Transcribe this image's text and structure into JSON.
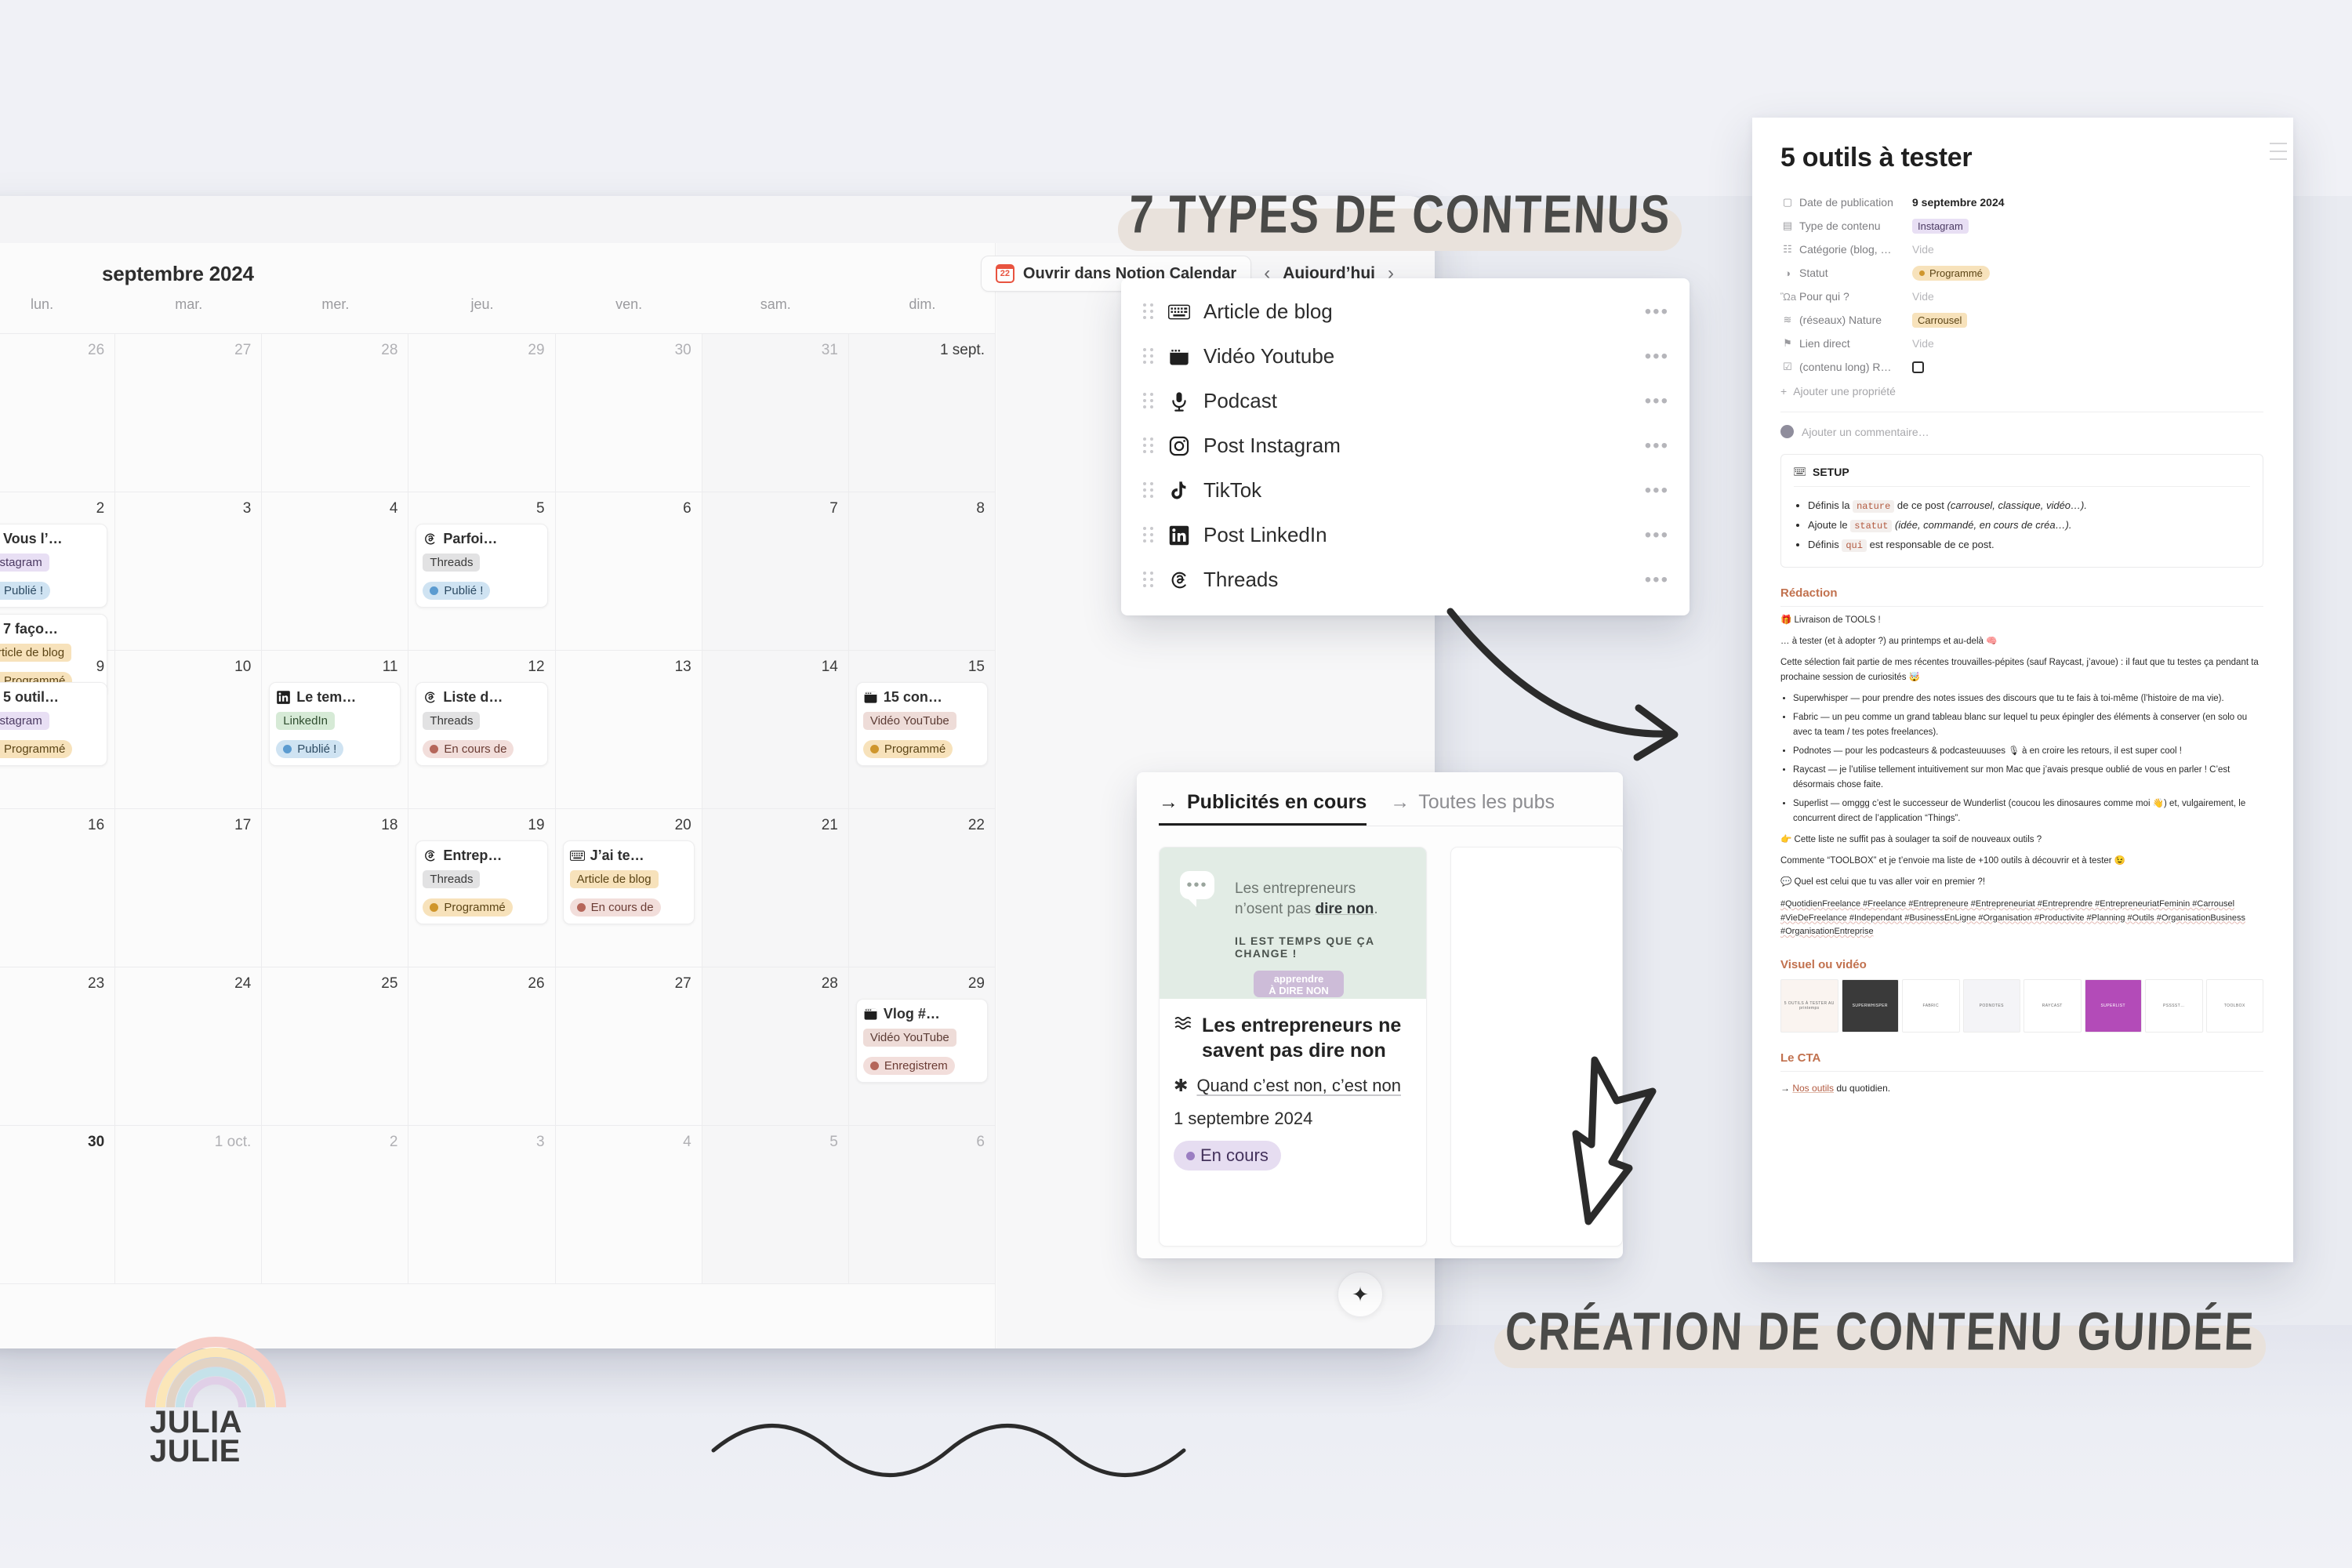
{
  "calendar": {
    "month_label": "septembre 2024",
    "open_button": "Ouvrir dans Notion Calendar",
    "today_button": "Aujourd’hui",
    "prev_icon": "‹",
    "next_icon": "›",
    "fab_icon": "✦",
    "weekdays": [
      "lun.",
      "mar.",
      "mer.",
      "jeu.",
      "ven.",
      "sam.",
      "dim."
    ],
    "weeks": [
      [
        {
          "num": "26",
          "muted": true,
          "events": []
        },
        {
          "num": "27",
          "muted": true,
          "events": []
        },
        {
          "num": "28",
          "muted": true,
          "events": []
        },
        {
          "num": "29",
          "muted": true,
          "events": []
        },
        {
          "num": "30",
          "muted": true,
          "events": []
        },
        {
          "num": "31",
          "muted": true,
          "weekend": true,
          "events": []
        },
        {
          "num": "1 sept.",
          "muted": false,
          "weekend": true,
          "events": []
        }
      ],
      [
        {
          "num": "2",
          "muted": false,
          "events": [
            {
              "icon": "instagram-icon",
              "title": "Vous l’…",
              "type": "Instagram",
              "type_bg": "#e8dff4",
              "type_fg": "#4b3a62",
              "status": "Publié !",
              "status_bg": "#cfe3f2",
              "status_fg": "#2d4b63",
              "status_dot": "#5b9bd0"
            },
            {
              "icon": "keyboard-icon",
              "title": "7 faço…",
              "type": "Article de blog",
              "type_bg": "#f7e2bb",
              "type_fg": "#5c4516",
              "status": "Programmé",
              "status_bg": "#f7e2bb",
              "status_fg": "#5c4516",
              "status_dot": "#cf962c"
            }
          ]
        },
        {
          "num": "3",
          "muted": false,
          "events": []
        },
        {
          "num": "4",
          "muted": false,
          "events": []
        },
        {
          "num": "5",
          "muted": false,
          "events": [
            {
              "icon": "threads-icon",
              "title": "Parfoi…",
              "type": "Threads",
              "type_bg": "#e2e2e3",
              "type_fg": "#3a3a3a",
              "status": "Publié !",
              "status_bg": "#cfe3f2",
              "status_fg": "#2d4b63",
              "status_dot": "#5b9bd0"
            }
          ]
        },
        {
          "num": "6",
          "muted": false,
          "events": []
        },
        {
          "num": "7",
          "muted": false,
          "weekend": true,
          "events": []
        },
        {
          "num": "8",
          "muted": false,
          "weekend": true,
          "events": []
        }
      ],
      [
        {
          "num": "9",
          "muted": false,
          "events": [
            {
              "icon": "instagram-icon",
              "title": "5 outil…",
              "type": "Instagram",
              "type_bg": "#e8dff4",
              "type_fg": "#4b3a62",
              "status": "Programmé",
              "status_bg": "#f7e2bb",
              "status_fg": "#5c4516",
              "status_dot": "#cf962c"
            }
          ]
        },
        {
          "num": "10",
          "muted": false,
          "events": []
        },
        {
          "num": "11",
          "muted": false,
          "events": [
            {
              "icon": "linkedin-icon",
              "title": "Le tem…",
              "type": "LinkedIn",
              "type_bg": "#d6ead6",
              "type_fg": "#2f4d2f",
              "status": "Publié !",
              "status_bg": "#cfe3f2",
              "status_fg": "#2d4b63",
              "status_dot": "#5b9bd0"
            }
          ]
        },
        {
          "num": "12",
          "muted": false,
          "events": [
            {
              "icon": "threads-icon",
              "title": "Liste d…",
              "type": "Threads",
              "type_bg": "#e2e2e3",
              "type_fg": "#3a3a3a",
              "status": "En cours de",
              "status_bg": "#f2dedb",
              "status_fg": "#6b3c34",
              "status_dot": "#b5665a"
            }
          ]
        },
        {
          "num": "13",
          "muted": false,
          "events": []
        },
        {
          "num": "14",
          "muted": false,
          "weekend": true,
          "events": []
        },
        {
          "num": "15",
          "muted": false,
          "weekend": true,
          "events": [
            {
              "icon": "youtube-icon",
              "title": "15 con…",
              "type": "Vidéo YouTube",
              "type_bg": "#eedcd8",
              "type_fg": "#5c3c35",
              "status": "Programmé",
              "status_bg": "#f7e2bb",
              "status_fg": "#5c4516",
              "status_dot": "#cf962c"
            }
          ]
        }
      ],
      [
        {
          "num": "16",
          "muted": false,
          "events": []
        },
        {
          "num": "17",
          "muted": false,
          "events": []
        },
        {
          "num": "18",
          "muted": false,
          "events": []
        },
        {
          "num": "19",
          "muted": false,
          "events": [
            {
              "icon": "threads-icon",
              "title": "Entrep…",
              "type": "Threads",
              "type_bg": "#e2e2e3",
              "type_fg": "#3a3a3a",
              "status": "Programmé",
              "status_bg": "#f7e2bb",
              "status_fg": "#5c4516",
              "status_dot": "#cf962c"
            }
          ]
        },
        {
          "num": "20",
          "muted": false,
          "events": [
            {
              "icon": "keyboard-icon",
              "title": "J’ai te…",
              "type": "Article de blog",
              "type_bg": "#f7e2bb",
              "type_fg": "#5c4516",
              "status": "En cours de",
              "status_bg": "#f2dedb",
              "status_fg": "#6b3c34",
              "status_dot": "#b5665a"
            }
          ]
        },
        {
          "num": "21",
          "muted": false,
          "weekend": true,
          "events": []
        },
        {
          "num": "22",
          "muted": false,
          "weekend": true,
          "events": []
        }
      ],
      [
        {
          "num": "23",
          "muted": false,
          "events": []
        },
        {
          "num": "24",
          "muted": false,
          "events": []
        },
        {
          "num": "25",
          "muted": false,
          "events": []
        },
        {
          "num": "26",
          "muted": false,
          "events": []
        },
        {
          "num": "27",
          "muted": false,
          "events": []
        },
        {
          "num": "28",
          "muted": false,
          "weekend": true,
          "events": []
        },
        {
          "num": "29",
          "muted": false,
          "weekend": true,
          "events": [
            {
              "icon": "youtube-icon",
              "title": "Vlog #…",
              "type": "Vidéo YouTube",
              "type_bg": "#eedcd8",
              "type_fg": "#5c3c35",
              "status": "Enregistrem",
              "status_bg": "#f2dedb",
              "status_fg": "#6b3c34",
              "status_dot": "#b5665a"
            }
          ]
        }
      ],
      [
        {
          "num": "30",
          "muted": false,
          "today": true,
          "events": []
        },
        {
          "num": "1 oct.",
          "muted": true,
          "events": []
        },
        {
          "num": "2",
          "muted": true,
          "events": []
        },
        {
          "num": "3",
          "muted": true,
          "events": []
        },
        {
          "num": "4",
          "muted": true,
          "events": []
        },
        {
          "num": "5",
          "muted": true,
          "weekend": true,
          "events": []
        },
        {
          "num": "6",
          "muted": true,
          "weekend": true,
          "events": []
        }
      ]
    ]
  },
  "brand": {
    "line1": "JULIA",
    "line2": "JULIE"
  },
  "headlines": {
    "types": "7 TYPES DE CONTENUS",
    "caption": "CRÉATION DE CONTENU GUIDÉE"
  },
  "types_panel": {
    "items": [
      {
        "label": "Article de blog",
        "icon": "keyboard-icon",
        "menu": "•••"
      },
      {
        "label": "Vidéo Youtube",
        "icon": "youtube-icon",
        "menu": "•••"
      },
      {
        "label": "Podcast",
        "icon": "microphone-icon",
        "menu": "•••"
      },
      {
        "label": "Post Instagram",
        "icon": "instagram-icon",
        "menu": "•••"
      },
      {
        "label": "TikTok",
        "icon": "tiktok-icon",
        "menu": "•••"
      },
      {
        "label": "Post LinkedIn",
        "icon": "linkedin-icon",
        "menu": "•••"
      },
      {
        "label": "Threads",
        "icon": "threads-icon",
        "menu": "•••"
      }
    ]
  },
  "ads": {
    "tab_active": "Publicités en cours",
    "tab_inactive": "Toutes les pubs",
    "arrow": "→",
    "card": {
      "thumb_line1": "Les entrepreneurs",
      "thumb_line2_a": "n’osent pas ",
      "thumb_line2_b": "dire non",
      "thumb_line2_c": ".",
      "thumb_sub": "IL EST TEMPS QUE ÇA CHANGE !",
      "thumb_btn_1": "apprendre",
      "thumb_btn_2": "À DIRE NON",
      "title": "Les entrepreneurs ne savent pas dire non",
      "subtitle": "Quand c’est non, c’est non",
      "date": "1 septembre 2024",
      "status": "En cours",
      "status_bg": "#e6ddf1",
      "status_fg": "#44325c",
      "status_dot": "#9b7ec2",
      "title_icon": "waves-icon",
      "sub_icon": "asterisk-icon"
    }
  },
  "doc": {
    "title": "5 outils à tester",
    "properties": [
      {
        "icon": "Ὕ3",
        "glyph": "▢",
        "name": "Date de publication",
        "value": "9 septembre 2024",
        "kind": "text"
      },
      {
        "icon": "▤",
        "glyph": "▤",
        "name": "Type de contenu",
        "value": "Instagram",
        "kind": "tag",
        "bg": "#e8dff4",
        "fg": "#4b3a62"
      },
      {
        "icon": "☰",
        "glyph": "☷",
        "name": "Catégorie (blog, …",
        "value": "Vide",
        "kind": "empty"
      },
      {
        "icon": "◑",
        "glyph": "◑",
        "name": "Statut",
        "value": "Programmé",
        "kind": "tag-round",
        "bg": "#f7e2bb",
        "fg": "#5c4516",
        "dot": "#cf962c"
      },
      {
        "icon": "Ὣ9",
        "glyph": "Ὣa",
        "name": "Pour qui ?",
        "value": "Vide",
        "kind": "empty"
      },
      {
        "icon": "≈",
        "glyph": "≋",
        "name": "(réseaux) Nature",
        "value": "Carrousel",
        "kind": "tag",
        "bg": "#f7e2bb",
        "fg": "#5c4516"
      },
      {
        "icon": "ὑ6",
        "glyph": "⚑",
        "name": "Lien direct",
        "value": "Vide",
        "kind": "empty"
      },
      {
        "icon": "☑",
        "glyph": "☑",
        "name": "(contenu long) R…",
        "value": "",
        "kind": "checkbox"
      }
    ],
    "add_property": "Ajouter une propriété",
    "comment_placeholder": "Ajouter un commentaire…",
    "callout": {
      "title": "SETUP",
      "icon": "keyboard-icon",
      "items": [
        {
          "pre": "Définis la ",
          "code": "nature",
          "mid": " de ce post ",
          "it": "(carrousel, classique, vidéo…).",
          "post": ""
        },
        {
          "pre": "Ajoute le ",
          "code": "statut",
          "mid": " ",
          "it": "(idée, commandé, en cours de créa…).",
          "post": ""
        },
        {
          "pre": "Définis ",
          "code": "qui",
          "mid": " est responsable de ce post.",
          "it": "",
          "post": ""
        }
      ]
    },
    "sections": {
      "redaction": "Rédaction",
      "visuel": "Visuel ou vidéo",
      "cta": "Le CTA"
    },
    "redaction": {
      "p1": "🎁 Livraison de TOOLS !",
      "p2": "… à tester (et à adopter ?) au printemps et au-delà 🧠",
      "p3": "Cette sélection fait partie de mes récentes trouvailles-pépites (sauf Raycast, j’avoue) : il faut que tu testes ça pendant ta prochaine session de curiosités 🤯",
      "bullets": [
        "Superwhisper — pour prendre des notes issues des discours que tu te fais à toi-même (l’histoire de ma vie).",
        "Fabric — un peu comme un grand tableau blanc sur lequel tu peux épingler des éléments à conserver (en solo ou avec ta team / tes potes freelances).",
        "Podnotes — pour les podcasteurs & podcasteuuuses 🎙 à en croire les retours, il est super cool !",
        "Raycast — je l’utilise tellement intuitivement sur mon Mac que j’avais presque oublié de vous en parler ! C’est désormais chose faite.",
        "Superlist — omggg c’est le successeur de Wunderlist (coucou les dinosaures comme moi 👋) et, vulgairement, le concurrent direct de l’application “Things”."
      ],
      "p4": "👉 Cette liste ne suffit pas à soulager ta soif de nouveaux outils ?",
      "p5": "Commente “TOOLBOX” et je t’envoie ma liste de +100 outils à découvrir et à tester 😉",
      "p6": "💬 Quel est celui que tu vas aller voir en premier ?!",
      "hashtags": "#QuotidienFreelance #Freelance #Entrepreneure #Entrepreneuriat #Entreprendre #EntrepreneuriatFeminin #Carrousel #VieDeFreelance #Independant #BusinessEnLigne #Organisation #Productivite #Planning #Outils #OrganisationBusiness #OrganisationEntreprise"
    },
    "gallery": [
      {
        "label": "5 OUTILS À TESTER AU printemps",
        "bg": "#faf4f0"
      },
      {
        "label": "SUPERWHISPER",
        "bg": "#3a3a3a"
      },
      {
        "label": "FABRIC",
        "bg": "#ffffff"
      },
      {
        "label": "PODNOTES",
        "bg": "#f4f4f7"
      },
      {
        "label": "RAYCAST",
        "bg": "#ffffff"
      },
      {
        "label": "SUPERLIST",
        "bg": "#b34bb8"
      },
      {
        "label": "PSSSST…",
        "bg": "#ffffff"
      },
      {
        "label": "TOOLBOX",
        "bg": "#ffffff"
      }
    ],
    "cta": {
      "link": "Nos outils",
      "rest": " du quotidien."
    }
  }
}
